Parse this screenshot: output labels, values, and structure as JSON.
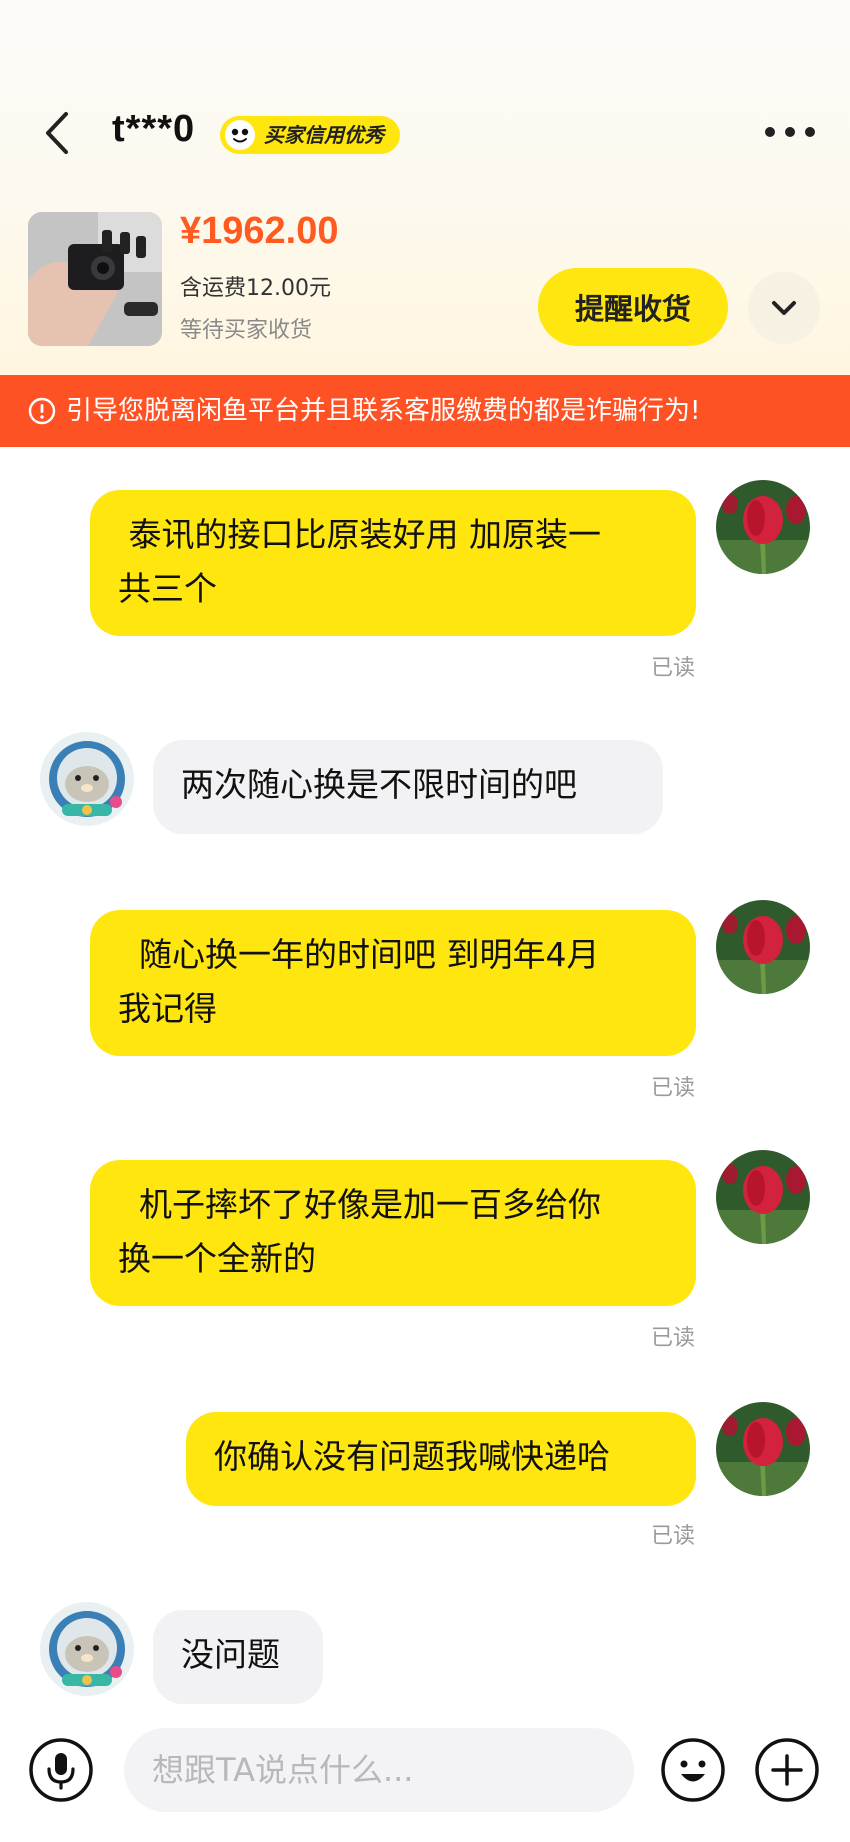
{
  "header": {
    "nickname": "t***0",
    "credit_badge": "买家信用优秀"
  },
  "product": {
    "price": "¥1962.00",
    "shipping": "含运费12.00元",
    "status": "等待买家收货",
    "remind_button": "提醒收货"
  },
  "warning": {
    "text": "引导您脱离闲鱼平台并且联系客服缴费的都是诈骗行为!"
  },
  "messages": [
    {
      "from": "me",
      "text": " 泰讯的接口比原装好用 加原装一\n共三个",
      "read": "已读"
    },
    {
      "from": "them",
      "text": "两次随心换是不限时间的吧"
    },
    {
      "from": "me",
      "text": "  随心换一年的时间吧 到明年4月\n我记得",
      "read": "已读"
    },
    {
      "from": "me",
      "text": "  机子摔坏了好像是加一百多给你\n换一个全新的",
      "read": "已读"
    },
    {
      "from": "me",
      "text": "你确认没有问题我喊快递哈",
      "read": "已读"
    },
    {
      "from": "them",
      "text": "没问题"
    }
  ],
  "input": {
    "placeholder": "想跟TA说点什么..."
  },
  "colors": {
    "accent": "#ffe60f",
    "price": "#ff5a1f",
    "warning_bg": "#ff5224"
  }
}
